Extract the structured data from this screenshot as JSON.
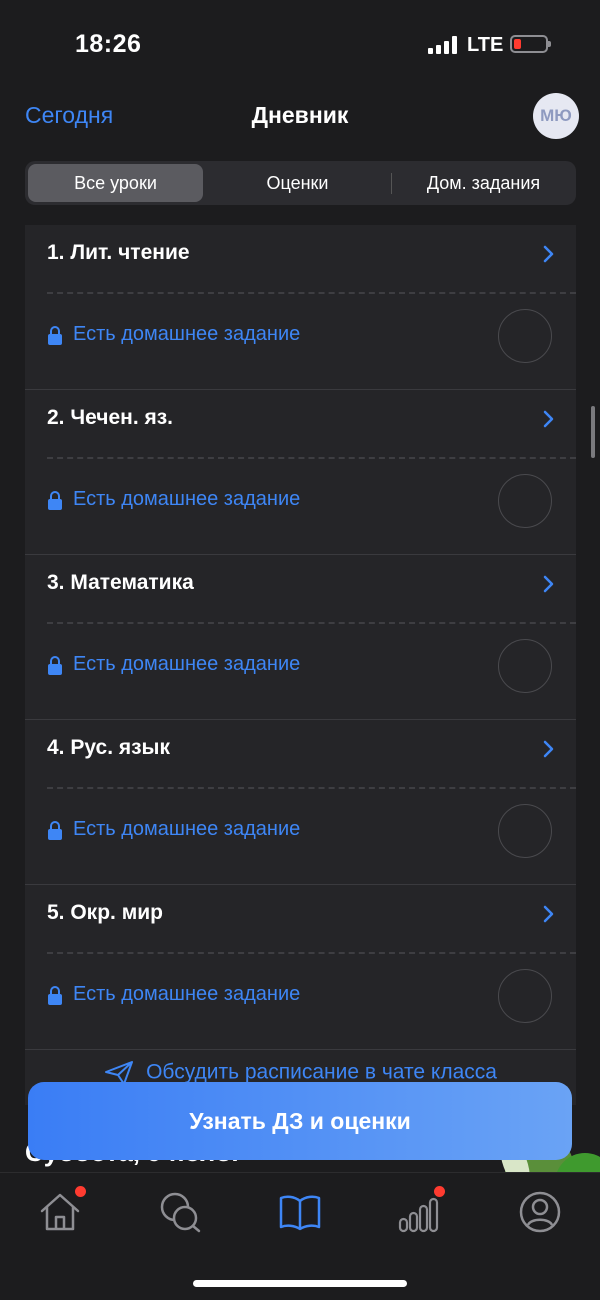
{
  "status_bar": {
    "time": "18:26",
    "network": "LTE",
    "battery_color": "#ff3b30"
  },
  "nav": {
    "left_link": "Сегодня",
    "title": "Дневник",
    "avatar_initials": "МЮ"
  },
  "segments": [
    {
      "label": "Все уроки",
      "active": true
    },
    {
      "label": "Оценки",
      "active": false
    },
    {
      "label": "Дом. задания",
      "active": false
    }
  ],
  "lessons": [
    {
      "title": "1. Лит. чтение",
      "homework": "Есть домашнее задание"
    },
    {
      "title": "2. Чечен. яз.",
      "homework": "Есть домашнее задание"
    },
    {
      "title": "3. Математика",
      "homework": "Есть домашнее задание"
    },
    {
      "title": "4. Рус. язык",
      "homework": "Есть домашнее задание"
    },
    {
      "title": "5. Окр. мир",
      "homework": "Есть домашнее задание"
    }
  ],
  "discuss_label": "Обсудить расписание в чате класса",
  "next_day_label": "Суббота, 9 нояб.",
  "cta_label": "Узнать ДЗ и оценки",
  "tabbar": [
    {
      "icon": "home-icon",
      "badge": true
    },
    {
      "icon": "chat-icon",
      "badge": false
    },
    {
      "icon": "diary-book-icon",
      "badge": false,
      "active": true
    },
    {
      "icon": "grades-chart-icon",
      "badge": true
    },
    {
      "icon": "profile-icon",
      "badge": false
    }
  ],
  "colors": {
    "accent": "#3e86f5",
    "background": "#1c1c1e",
    "card": "#252528",
    "badge": "#ff3b30"
  }
}
